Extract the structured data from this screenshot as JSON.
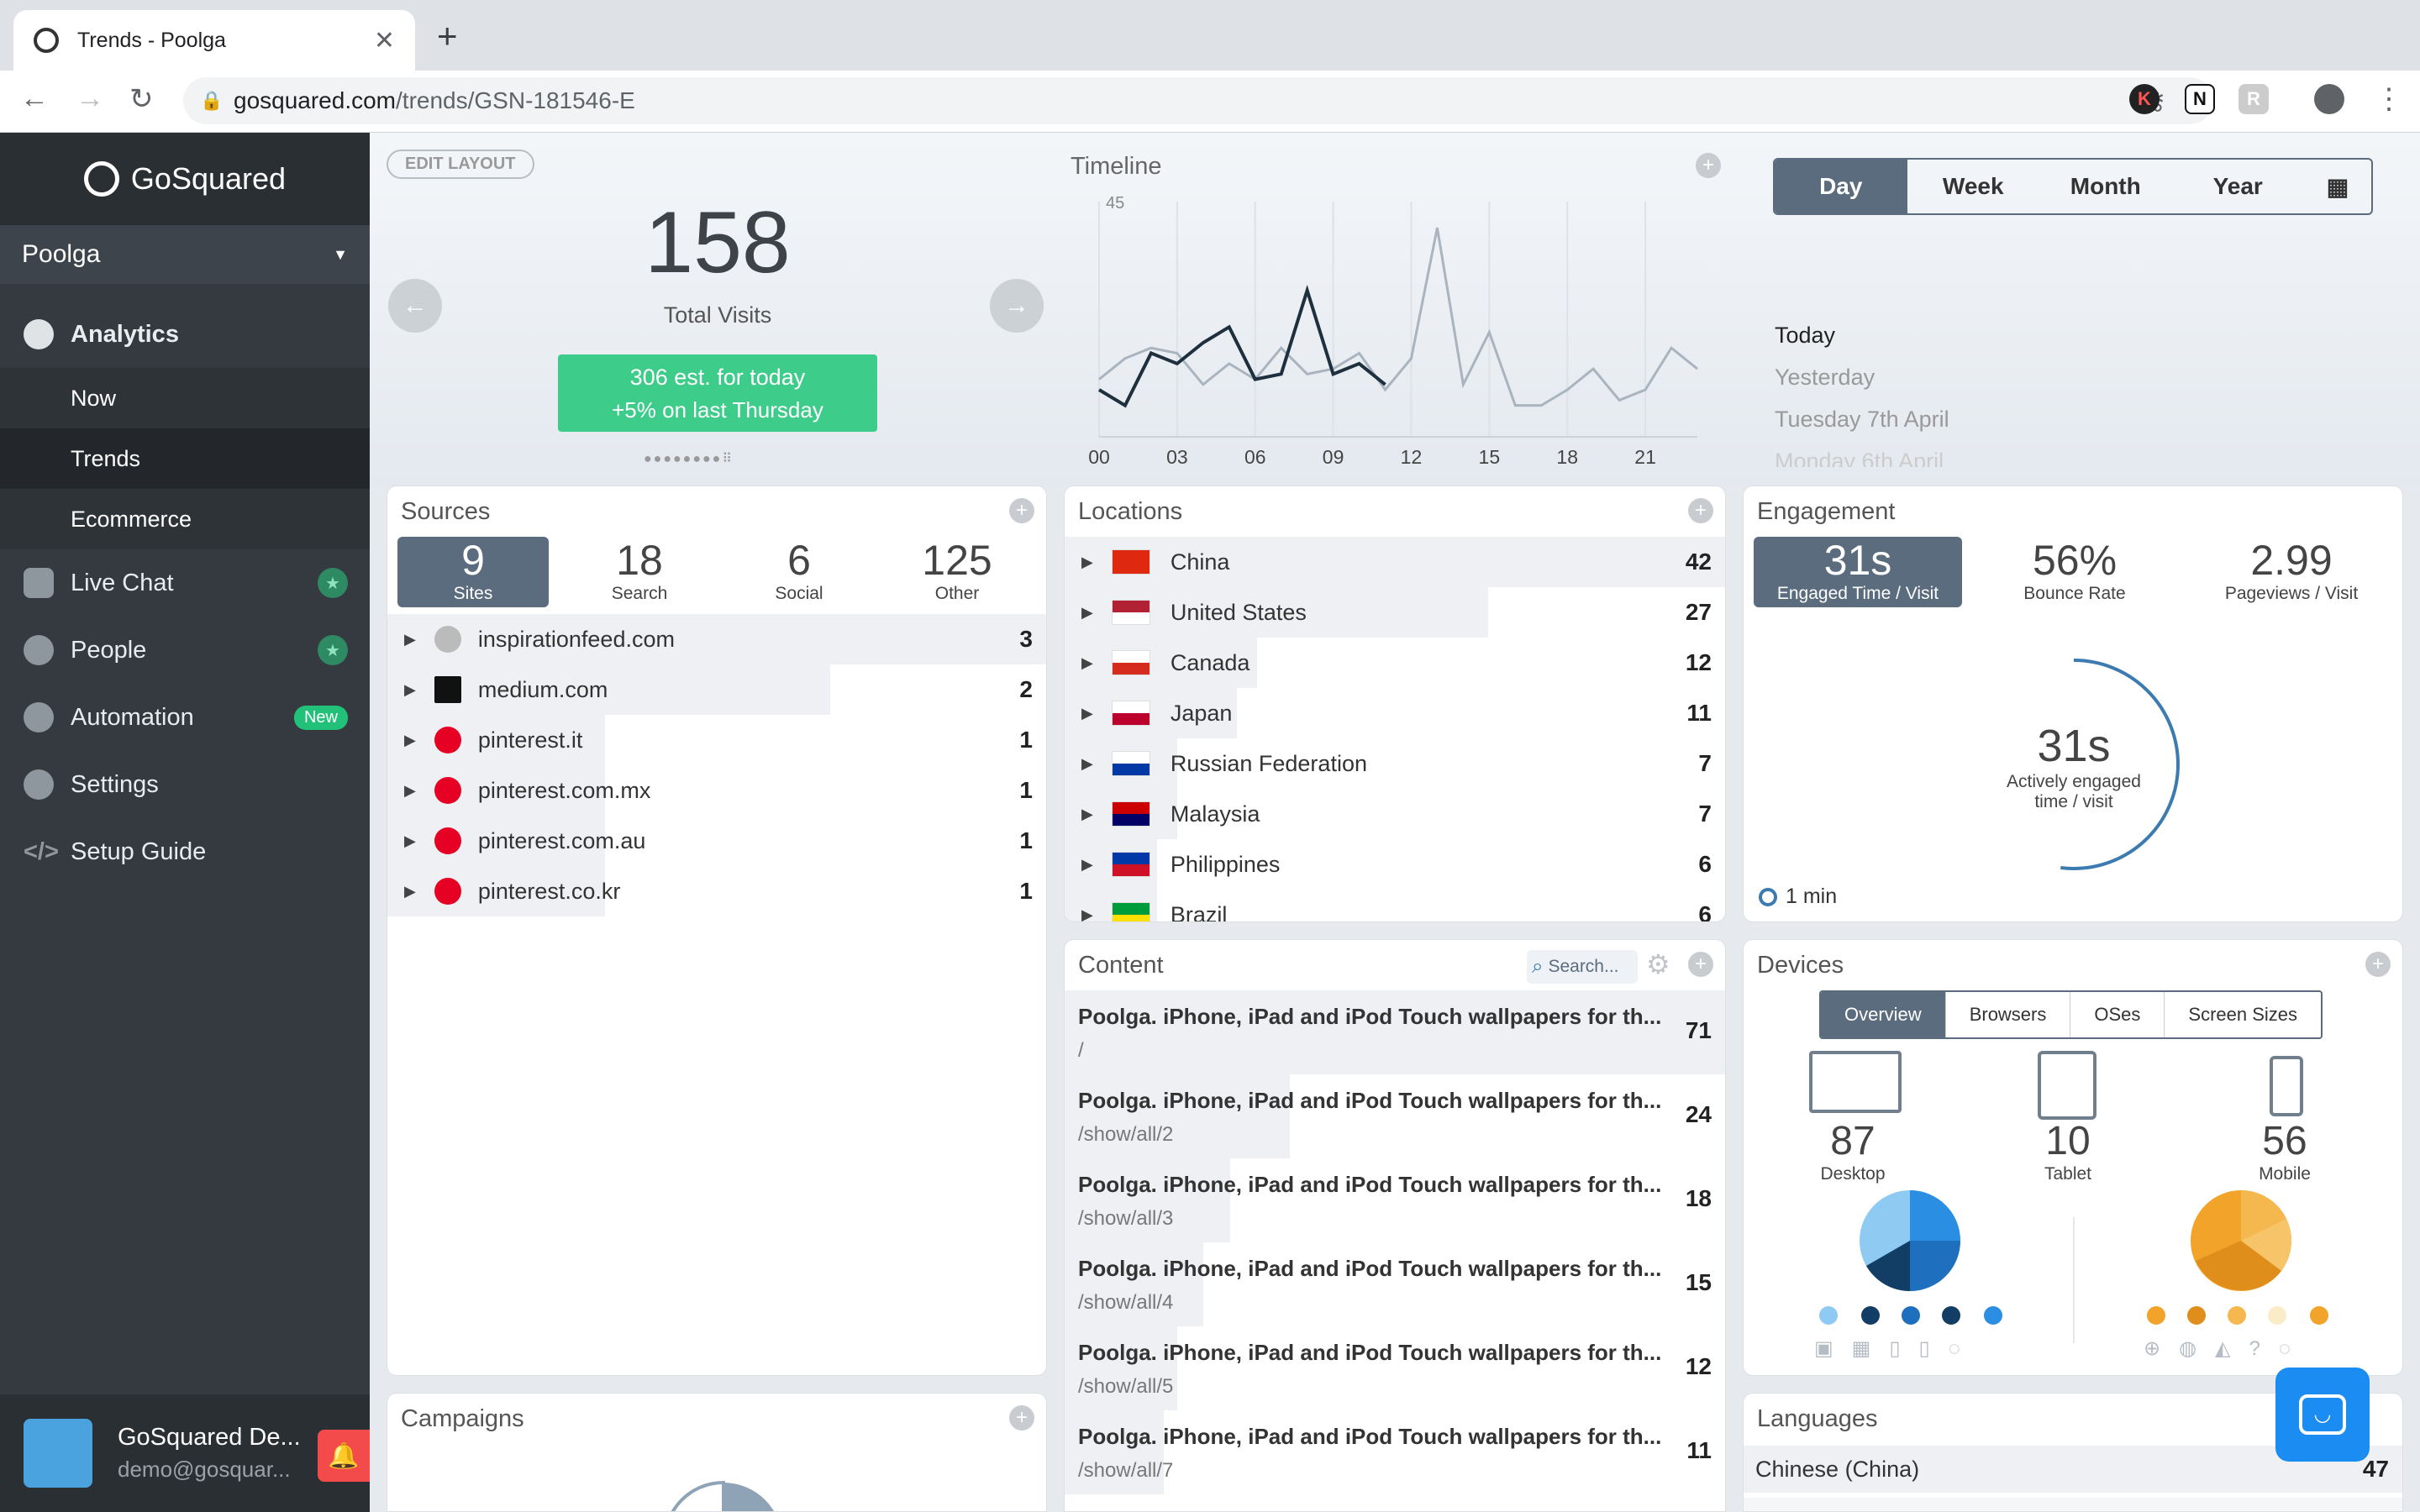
{
  "browser": {
    "tab_title": "Trends - Poolga",
    "url_host": "gosquared.com",
    "url_path": "/trends/GSN-181546-E"
  },
  "sidebar": {
    "brand": "GoSquared",
    "project": "Poolga",
    "items": [
      {
        "label": "Analytics"
      },
      {
        "label": "Now"
      },
      {
        "label": "Trends"
      },
      {
        "label": "Ecommerce"
      },
      {
        "label": "Live Chat"
      },
      {
        "label": "People"
      },
      {
        "label": "Automation",
        "badge": "New"
      },
      {
        "label": "Settings"
      },
      {
        "label": "Setup Guide"
      }
    ],
    "user_name": "GoSquared De...",
    "user_email": "demo@gosquar..."
  },
  "header": {
    "edit_layout": "EDIT LAYOUT",
    "total_visits": "158",
    "total_visits_label": "Total Visits",
    "estimate_line1": "306 est. for today",
    "estimate_line2": "+5% on last Thursday",
    "timeline_title": "Timeline",
    "ranges": [
      "Day",
      "Week",
      "Month",
      "Year"
    ],
    "active_range": "Day",
    "dates": [
      "Today",
      "Yesterday",
      "Tuesday 7th April",
      "Monday 6th April"
    ]
  },
  "chart_data": {
    "type": "line",
    "title": "Timeline",
    "x": [
      "00",
      "01",
      "02",
      "03",
      "04",
      "05",
      "06",
      "07",
      "08",
      "09",
      "10",
      "11",
      "12",
      "13",
      "14",
      "15",
      "16",
      "17",
      "18",
      "19",
      "20",
      "21",
      "22",
      "23"
    ],
    "x_ticks": [
      "00",
      "03",
      "06",
      "09",
      "12",
      "15",
      "18",
      "21"
    ],
    "ylim": [
      0,
      45
    ],
    "y_ticks": [
      "45"
    ],
    "series": [
      {
        "values": [
          11,
          15,
          17,
          16,
          10,
          14,
          11,
          17,
          12,
          13,
          16,
          9,
          15,
          40,
          10,
          20,
          6,
          6,
          9,
          13,
          7,
          9,
          17,
          13
        ],
        "color": "#a9b4bf"
      },
      {
        "values": [
          9,
          6,
          16,
          14,
          18,
          21,
          11,
          12,
          28,
          12,
          14,
          10
        ],
        "color": "#1e2f3d"
      }
    ]
  },
  "sources": {
    "title": "Sources",
    "stats": [
      {
        "value": "9",
        "label": "Sites"
      },
      {
        "value": "18",
        "label": "Search"
      },
      {
        "value": "6",
        "label": "Social"
      },
      {
        "value": "125",
        "label": "Other"
      }
    ],
    "rows": [
      {
        "name": "inspirationfeed.com",
        "count": "3",
        "share": 1.0
      },
      {
        "name": "medium.com",
        "count": "2",
        "share": 0.67
      },
      {
        "name": "pinterest.it",
        "count": "1",
        "share": 0.33
      },
      {
        "name": "pinterest.com.mx",
        "count": "1",
        "share": 0.33
      },
      {
        "name": "pinterest.com.au",
        "count": "1",
        "share": 0.33
      },
      {
        "name": "pinterest.co.kr",
        "count": "1",
        "share": 0.33
      }
    ]
  },
  "locations": {
    "title": "Locations",
    "rows": [
      {
        "name": "China",
        "count": "42",
        "share": 1.0
      },
      {
        "name": "United States",
        "count": "27",
        "share": 0.64
      },
      {
        "name": "Canada",
        "count": "12",
        "share": 0.29
      },
      {
        "name": "Japan",
        "count": "11",
        "share": 0.26
      },
      {
        "name": "Russian Federation",
        "count": "7",
        "share": 0.17
      },
      {
        "name": "Malaysia",
        "count": "7",
        "share": 0.17
      },
      {
        "name": "Philippines",
        "count": "6",
        "share": 0.14
      },
      {
        "name": "Brazil",
        "count": "6",
        "share": 0.14
      }
    ]
  },
  "engagement": {
    "title": "Engagement",
    "stats": [
      {
        "value": "31s",
        "label": "Engaged Time / Visit"
      },
      {
        "value": "56%",
        "label": "Bounce Rate"
      },
      {
        "value": "2.99",
        "label": "Pageviews / Visit"
      }
    ],
    "ring_value": "31s",
    "ring_label1": "Actively engaged",
    "ring_label2": "time / visit",
    "ring_fraction": 0.52,
    "legend": "1 min"
  },
  "content": {
    "title": "Content",
    "search_placeholder": "Search...",
    "rows": [
      {
        "title": "Poolga. iPhone, iPad and iPod Touch wallpapers for th...",
        "path": "/",
        "count": "71",
        "share": 1.0
      },
      {
        "title": "Poolga. iPhone, iPad and iPod Touch wallpapers for th...",
        "path": "/show/all/2",
        "count": "24",
        "share": 0.34
      },
      {
        "title": "Poolga. iPhone, iPad and iPod Touch wallpapers for th...",
        "path": "/show/all/3",
        "count": "18",
        "share": 0.25
      },
      {
        "title": "Poolga. iPhone, iPad and iPod Touch wallpapers for th...",
        "path": "/show/all/4",
        "count": "15",
        "share": 0.21
      },
      {
        "title": "Poolga. iPhone, iPad and iPod Touch wallpapers for th...",
        "path": "/show/all/5",
        "count": "12",
        "share": 0.17
      },
      {
        "title": "Poolga. iPhone, iPad and iPod Touch wallpapers for th...",
        "path": "/show/all/7",
        "count": "11",
        "share": 0.15
      }
    ]
  },
  "devices": {
    "title": "Devices",
    "tabs": [
      "Overview",
      "Browsers",
      "OSes",
      "Screen Sizes"
    ],
    "types": [
      {
        "value": "87",
        "label": "Desktop"
      },
      {
        "value": "10",
        "label": "Tablet"
      },
      {
        "value": "56",
        "label": "Mobile"
      }
    ]
  },
  "campaigns": {
    "title": "Campaigns"
  },
  "languages": {
    "title": "Languages",
    "rows": [
      {
        "name": "Chinese (China)",
        "count": "47"
      }
    ]
  }
}
